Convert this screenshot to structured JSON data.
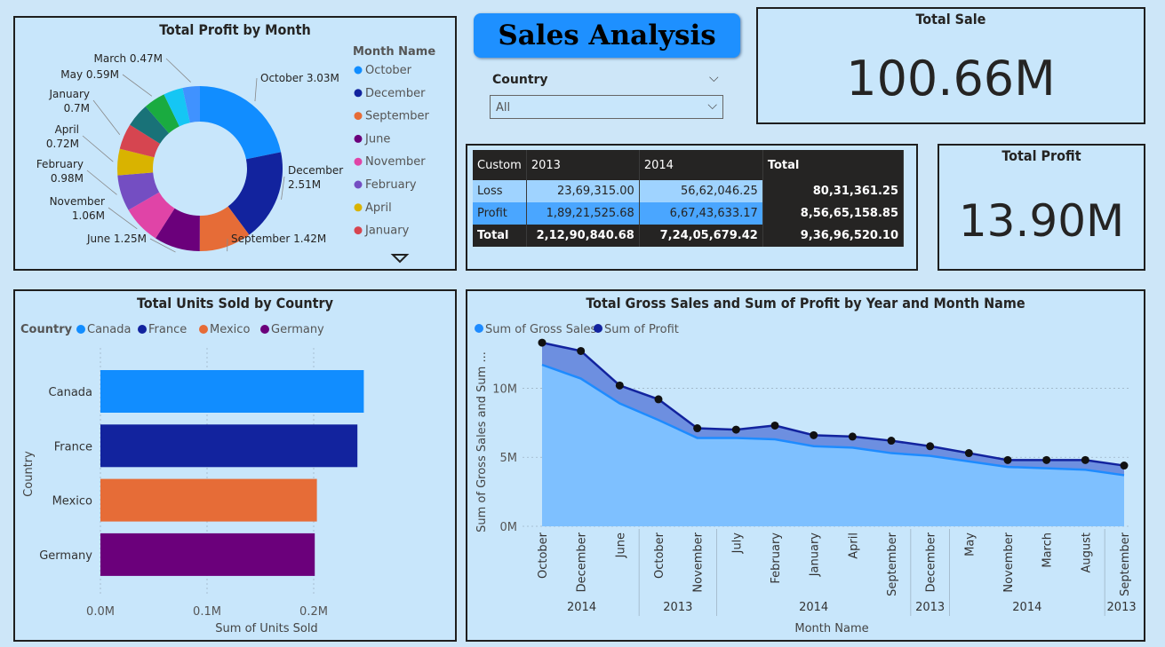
{
  "title": "Sales Analysis",
  "slicer": {
    "label": "Country",
    "value": "All"
  },
  "kpis": {
    "total_sale": {
      "label": "Total Sale",
      "value": "100.66M"
    },
    "total_profit": {
      "label": "Total Profit",
      "value": "13.90M"
    }
  },
  "matrix": {
    "headers": [
      "Custom",
      "2013",
      "2014",
      "Total"
    ],
    "rows": [
      {
        "label": "Loss",
        "v2013": "23,69,315.00",
        "v2014": "56,62,046.25",
        "total": "80,31,361.25"
      },
      {
        "label": "Profit",
        "v2013": "1,89,21,525.68",
        "v2014": "6,67,43,633.17",
        "total": "8,56,65,158.85"
      },
      {
        "label": "Total",
        "v2013": "2,12,90,840.68",
        "v2014": "7,24,05,679.42",
        "total": "9,36,96,520.10"
      }
    ]
  },
  "colors": {
    "donut": [
      "#118DFF",
      "#12239E",
      "#E66C37",
      "#6B007B",
      "#E044A7",
      "#744EC2",
      "#D9B300",
      "#D64550",
      "#197278",
      "#1AAB40",
      "#15C6F4",
      "#4092FF"
    ],
    "countries": [
      "#118DFF",
      "#12239E",
      "#E66C37",
      "#6B007B"
    ],
    "gross_area": "#7ec0ff",
    "gross_line": "#1e8bff",
    "profit_line": "#12239E",
    "profit_area": "#6d8fe0"
  },
  "chart_data": [
    {
      "type": "pie",
      "title": "Total Profit by Month",
      "legend_title": "Month Name",
      "legend_position": "right",
      "legend": [
        "October",
        "December",
        "September",
        "June",
        "November",
        "February",
        "April",
        "January"
      ],
      "slices": [
        {
          "label": "October",
          "value": 3.03,
          "text": "October 3.03M"
        },
        {
          "label": "December",
          "value": 2.51,
          "text": "December 2.51M"
        },
        {
          "label": "September",
          "value": 1.42,
          "text": "September 1.42M"
        },
        {
          "label": "June",
          "value": 1.25,
          "text": "June 1.25M"
        },
        {
          "label": "November",
          "value": 1.06,
          "text": "November 1.06M"
        },
        {
          "label": "February",
          "value": 0.98,
          "text": "February 0.98M"
        },
        {
          "label": "April",
          "value": 0.72,
          "text": "April 0.72M"
        },
        {
          "label": "January",
          "value": 0.7,
          "text": "January 0.7M"
        },
        {
          "label": "",
          "value": 0.65,
          "text": ""
        },
        {
          "label": "May",
          "value": 0.59,
          "text": "May 0.59M"
        },
        {
          "label": "",
          "value": 0.53,
          "text": ""
        },
        {
          "label": "March",
          "value": 0.47,
          "text": "March 0.47M"
        }
      ]
    },
    {
      "type": "bar",
      "title": "Total Units Sold by Country",
      "legend_title": "Country",
      "categories": [
        "Canada",
        "France",
        "Mexico",
        "Germany"
      ],
      "values": [
        247,
        241,
        203,
        201
      ],
      "value_unit": "thousand units",
      "xlabel": "Sum of Units Sold",
      "ylabel": "Country",
      "xticks": [
        "0.0M",
        "0.1M",
        "0.2M"
      ],
      "xlim": [
        0,
        0.25
      ],
      "grid": true
    },
    {
      "type": "area",
      "title": "Total Gross Sales and Sum of Profit by Year and Month Name",
      "legend_position": "top-left",
      "xlabel": "Month Name",
      "ylabel": "Sum of Gross Sales and Sum ...",
      "yticks": [
        "0M",
        "5M",
        "10M"
      ],
      "ylim": [
        0,
        13.5
      ],
      "categories": [
        "October",
        "December",
        "June",
        "October",
        "November",
        "July",
        "February",
        "January",
        "April",
        "September",
        "December",
        "May",
        "November",
        "March",
        "August",
        "September"
      ],
      "year_groups": [
        {
          "label": "2014",
          "span": 3
        },
        {
          "label": "2013",
          "span": 2
        },
        {
          "label": "2014",
          "span": 5
        },
        {
          "label": "2013",
          "span": 1
        },
        {
          "label": "2014",
          "span": 4
        },
        {
          "label": "2013",
          "span": 1
        }
      ],
      "series": [
        {
          "name": "Sum of Gross Sales",
          "values": [
            11.7,
            10.7,
            8.9,
            7.7,
            6.4,
            6.4,
            6.3,
            5.8,
            5.7,
            5.3,
            5.1,
            4.7,
            4.3,
            4.2,
            4.1,
            3.7
          ]
        },
        {
          "name": "Sum of Profit",
          "values": [
            13.3,
            12.7,
            10.2,
            9.2,
            7.1,
            7.0,
            7.3,
            6.6,
            6.5,
            6.2,
            5.8,
            5.3,
            4.8,
            4.8,
            4.8,
            4.4
          ]
        }
      ]
    }
  ]
}
